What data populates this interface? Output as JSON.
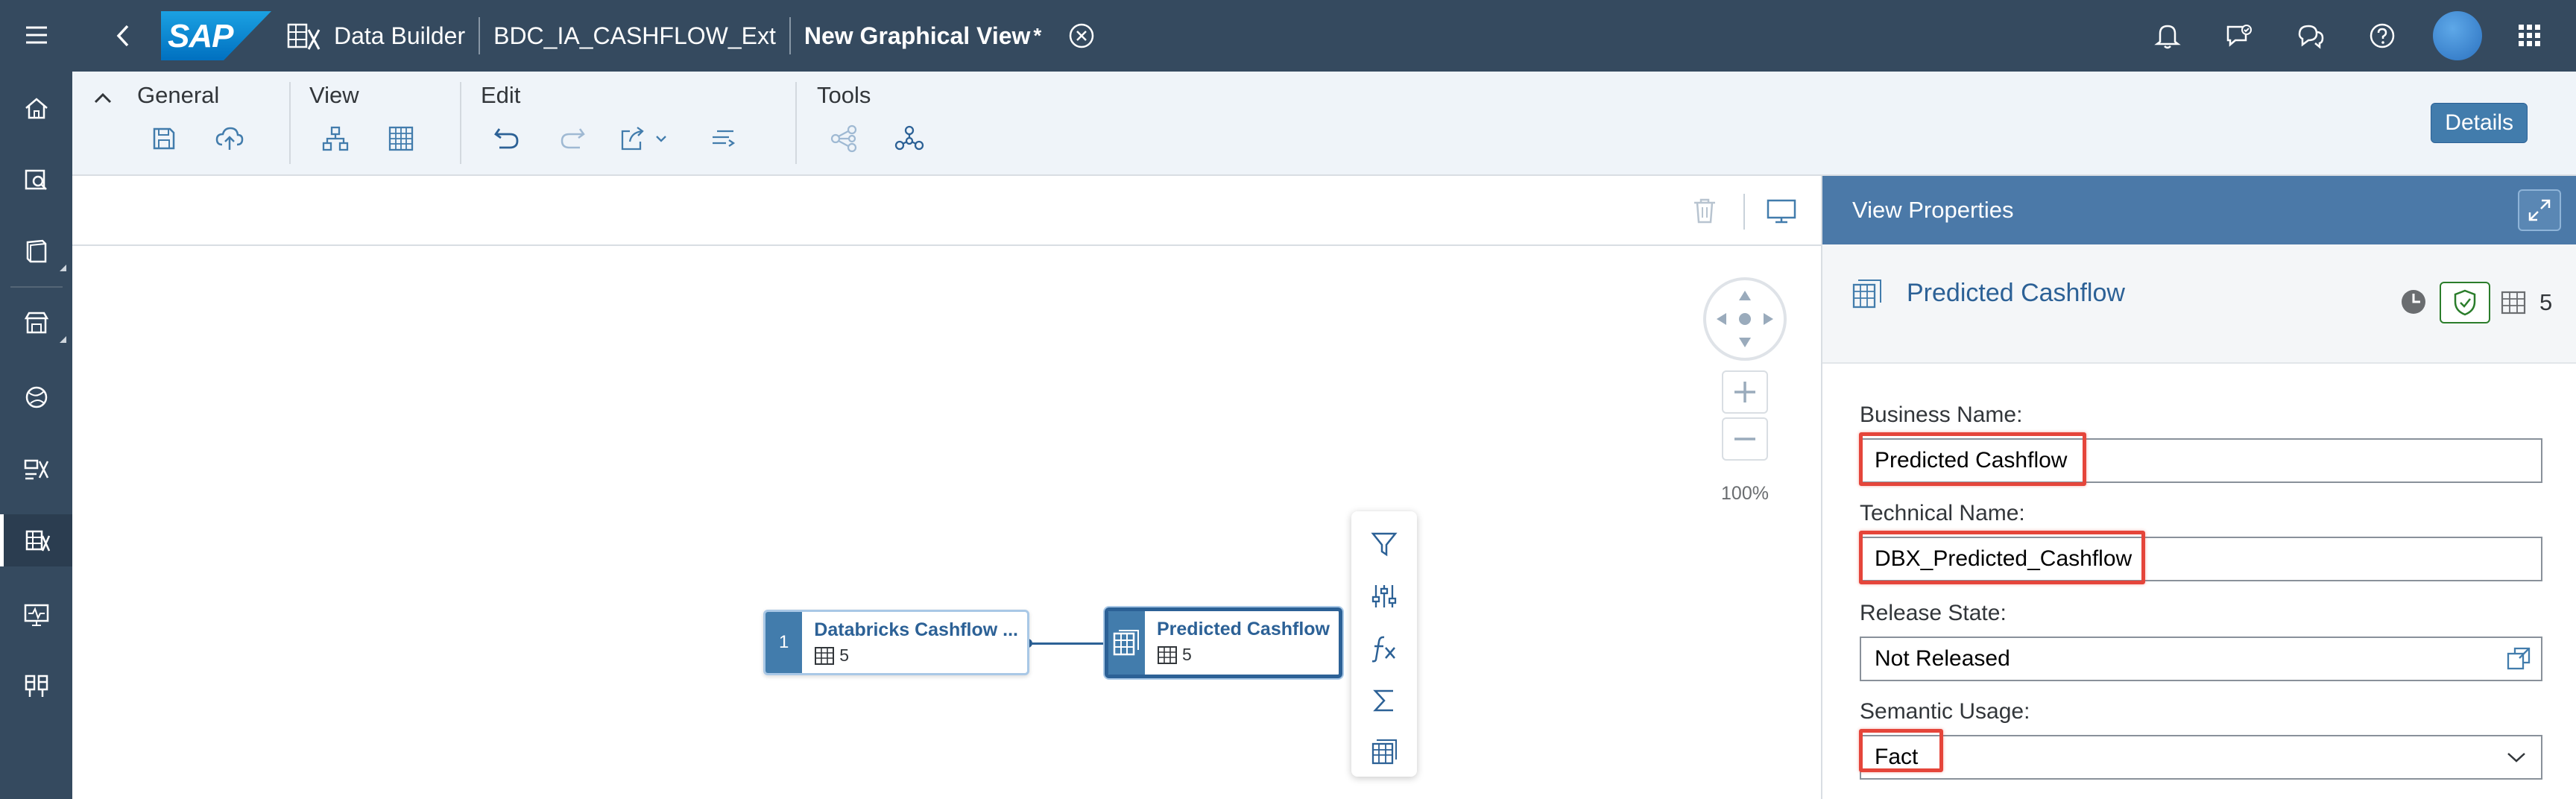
{
  "shell": {
    "app_name": "Data Builder",
    "space": "BDC_IA_CASHFLOW_Ext",
    "document_title": "New Graphical View",
    "modified_marker": "*",
    "logo_text": "SAP"
  },
  "toolbar": {
    "groups": [
      {
        "label": "General"
      },
      {
        "label": "View"
      },
      {
        "label": "Edit"
      },
      {
        "label": "Tools"
      }
    ],
    "details_label": "Details"
  },
  "canvas": {
    "zoom": "100%",
    "source_node": {
      "badge": "1",
      "title": "Databricks Cashflow ...",
      "column_count": "5"
    },
    "view_node": {
      "title": "Predicted Cashflow",
      "column_count": "5"
    }
  },
  "panel": {
    "header": "View Properties",
    "object_name": "Predicted Cashflow",
    "column_count": "5",
    "fields": {
      "business_name": {
        "label": "Business Name:",
        "value": "Predicted Cashflow"
      },
      "technical_name": {
        "label": "Technical Name:",
        "value": "DBX_Predicted_Cashflow"
      },
      "release_state": {
        "label": "Release State:",
        "value": "Not Released"
      },
      "semantic_usage": {
        "label": "Semantic Usage:",
        "value": "Fact"
      }
    }
  },
  "colors": {
    "shell_bg": "#354a5f",
    "accent": "#427cac",
    "highlight": "#e5453a"
  }
}
